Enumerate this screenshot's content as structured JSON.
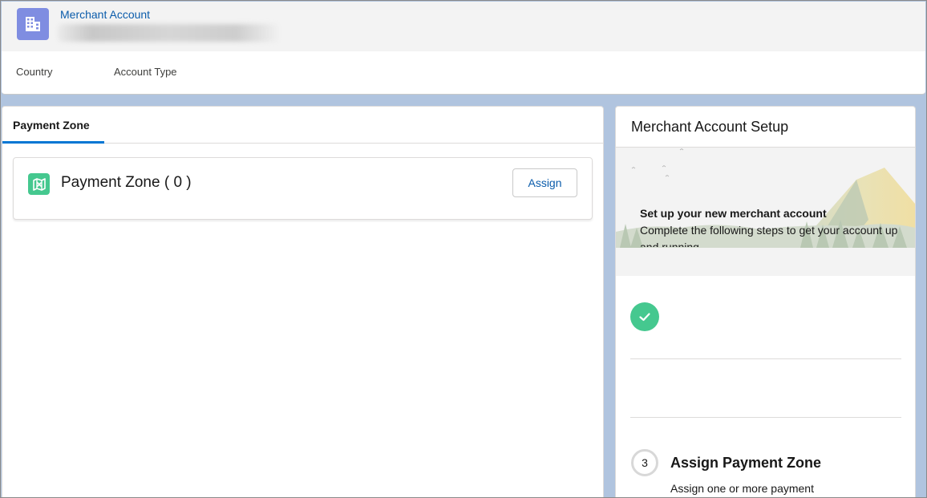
{
  "header": {
    "record_type": "Merchant Account",
    "icon": "building-icon",
    "fields": [
      {
        "label": "Country"
      },
      {
        "label": "Account Type"
      }
    ]
  },
  "left": {
    "tab_label": "Payment Zone",
    "related_list": {
      "icon": "payment-zone-icon",
      "title": "Payment Zone ( 0 )",
      "assign_label": "Assign"
    }
  },
  "right": {
    "title": "Merchant Account Setup",
    "banner": {
      "heading": "Set up your new merchant account",
      "text": "Complete the following steps to get your account up and running"
    },
    "steps": {
      "completed_icon": "check-icon",
      "step_number": "3",
      "step_title": "Assign Payment Zone",
      "step_description": "Assign one or more payment"
    }
  },
  "colors": {
    "brand_link": "#0b5cab",
    "tab_active": "#0176d3",
    "success": "#45c88f",
    "record_icon": "#7f8de1",
    "page_bg": "#b0c4df"
  }
}
